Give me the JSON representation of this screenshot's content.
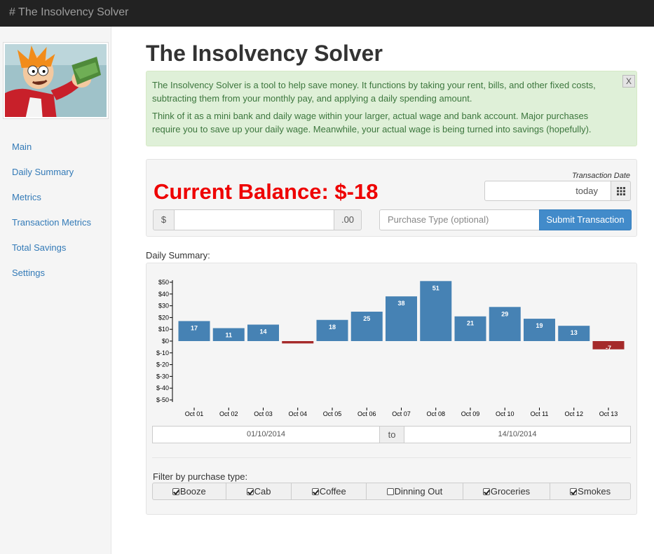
{
  "app": {
    "brand": "# The Insolvency Solver"
  },
  "sidebar": {
    "items": [
      {
        "label": "Main"
      },
      {
        "label": "Daily Summary"
      },
      {
        "label": "Metrics"
      },
      {
        "label": "Transaction Metrics"
      },
      {
        "label": "Total Savings"
      },
      {
        "label": "Settings"
      }
    ]
  },
  "page": {
    "title": "The Insolvency Solver"
  },
  "alert": {
    "p1": "The Insolvency Solver is a tool to help save money. It functions by taking your rent, bills, and other fixed costs, subtracting them from your monthly pay, and applying a daily spending amount.",
    "p2": "Think of it as a mini bank and daily wage within your larger, actual wage and bank account. Major purchases require you to save up your daily wage. Meanwhile, your actual wage is being turned into savings (hopefully).",
    "close_label": "X"
  },
  "transaction": {
    "balance": "Current Balance: $-18",
    "date_label": "Transaction Date",
    "date_value": "today",
    "currency_prefix": "$",
    "currency_suffix": ".00",
    "amount_value": "",
    "purchase_type_placeholder": "Purchase Type (optional)",
    "submit_label": "Submit Transaction"
  },
  "summary": {
    "label": "Daily Summary:",
    "range_from": "01/10/2014",
    "range_to_label": "to",
    "range_to": "14/10/2014",
    "filter_label": "Filter by purchase type:",
    "filters": [
      {
        "label": "Booze",
        "checked": true
      },
      {
        "label": "Cab",
        "checked": true
      },
      {
        "label": "Coffee",
        "checked": true
      },
      {
        "label": "Dinning Out",
        "checked": false
      },
      {
        "label": "Groceries",
        "checked": true
      },
      {
        "label": "Smokes",
        "checked": true
      }
    ]
  },
  "colors": {
    "positive": "#4682b4",
    "negative": "#a52a2a",
    "balance": "#ee0000",
    "accent": "#428bca"
  },
  "chart_data": {
    "type": "bar",
    "categories": [
      "Oct 01",
      "Oct 02",
      "Oct 03",
      "Oct 04",
      "Oct 05",
      "Oct 06",
      "Oct 07",
      "Oct 08",
      "Oct 09",
      "Oct 10",
      "Oct 11",
      "Oct 12",
      "Oct 13"
    ],
    "values": [
      17,
      11,
      14,
      -2,
      18,
      25,
      38,
      51,
      21,
      29,
      19,
      13,
      -7
    ],
    "labels": [
      "17",
      "11",
      "14",
      "",
      "18",
      "25",
      "38",
      "51",
      "21",
      "29",
      "19",
      "13",
      "-7"
    ],
    "yticks": [
      "$50",
      "$40",
      "$30",
      "$20",
      "$10",
      "$0",
      "$-10",
      "$-20",
      "$-30",
      "$-40",
      "$-50"
    ],
    "ytick_values": [
      50,
      40,
      30,
      20,
      10,
      0,
      -10,
      -20,
      -30,
      -40,
      -50
    ],
    "ylim": [
      -55,
      55
    ]
  }
}
